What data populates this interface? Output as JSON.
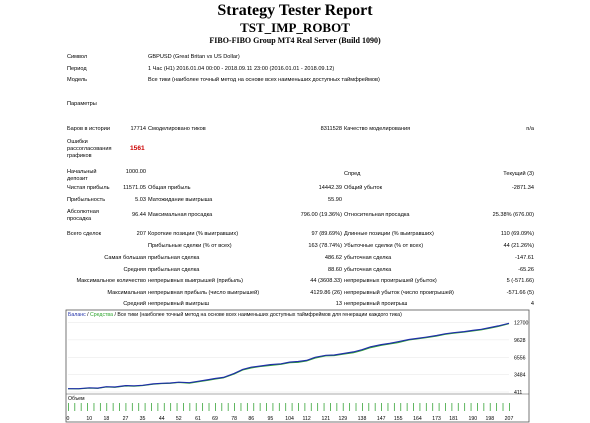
{
  "report": {
    "title": "Strategy Tester Report",
    "robot": "TST_IMP_ROBOT",
    "server": "FIBO-FIBO Group MT4 Real Server (Build 1090)"
  },
  "header": {
    "symbol_label": "Символ",
    "symbol_value": "GBPUSD (Great Britan vs US Dollar)",
    "period_label": "Период",
    "period_value": "1 Час (H1) 2016.01.04 00:00 - 2018.09.11 23:00 (2016.01.01 - 2018.09.12)",
    "model_label": "Модель",
    "model_value": "Все тики (наиболее точный метод на основе всех наименьших доступных таймфреймов)",
    "params_label": "Параметры"
  },
  "stats": {
    "bars_label": "Баров в истории",
    "bars_value": "17714",
    "ticks_label": "Смоделировано тиков",
    "ticks_value": "8311528",
    "quality_label": "Качество моделирования",
    "quality_value": "n/a",
    "errors_label": "Ошибки рассогласования графиков",
    "errors_value": "1561",
    "deposit_label": "Начальный депозит",
    "deposit_value": "1000.00",
    "spread_label": "Спред",
    "spread_value": "Текущий (3)",
    "net_profit_label": "Чистая прибыль",
    "net_profit_value": "11571.05",
    "gross_profit_label": "Общая прибыль",
    "gross_profit_value": "14442.39",
    "gross_loss_label": "Общий убыток",
    "gross_loss_value": "-2871.34",
    "profit_factor_label": "Прибыльность",
    "profit_factor_value": "5.03",
    "expected_payoff_label": "Матожидание выигрыша",
    "expected_payoff_value": "55.90",
    "abs_drawdown_label": "Абсолютная просадка",
    "abs_drawdown_value": "96.44",
    "max_drawdown_label": "Максимальная просадка",
    "max_drawdown_value": "796.00 (19.36%)",
    "rel_drawdown_label": "Относительная просадка",
    "rel_drawdown_value": "25.38% (676.00)",
    "total_trades_label": "Всего сделок",
    "total_trades_value": "207",
    "short_label": "Короткие позиции (% выигравших)",
    "short_value": "97 (89.69%)",
    "long_label": "Длинные позиции (% выигравших)",
    "long_value": "110 (69.09%)",
    "profit_trades_label": "Прибыльные сделки (% от всех)",
    "profit_trades_value": "163 (78.74%)",
    "loss_trades_label": "Убыточные сделки (% от всех)",
    "loss_trades_value": "44 (21.26%)",
    "largest_label": "Самая большая",
    "largest_profit_label": "прибыльная сделка",
    "largest_profit_value": "486.62",
    "largest_loss_label": "убыточная сделка",
    "largest_loss_value": "-147.61",
    "average_label": "Средняя",
    "average_profit_label": "прибыльная сделка",
    "average_profit_value": "88.60",
    "average_loss_label": "убыточная сделка",
    "average_loss_value": "-65.26",
    "max_count_label": "Максимальное количество",
    "consec_wins_label": "непрерывных выигрышей (прибыль)",
    "consec_wins_value": "44 (3608.33)",
    "consec_losses_label": "непрерывных проигрышей (убыток)",
    "consec_losses_value": "5 (-571.66)",
    "max_label": "Максимальная",
    "consec_profit_label": "непрерывная прибыль (число выигрышей)",
    "consec_profit_value": "4129.86 (26)",
    "consec_loss_label": "непрерывный убыток (число проигрышей)",
    "consec_loss_value": "-571.66 (5)",
    "avg_label": "Средний",
    "avg_wins_label": "непрерывный выигрыш",
    "avg_wins_value": "13",
    "avg_losses_label": "непрерывный проигрыш",
    "avg_losses_value": "4"
  },
  "chart_data": {
    "type": "line",
    "legend_balance": "Баланс",
    "legend_sep": "/",
    "legend_equity": "Средства",
    "legend_sep2": "/",
    "legend_text": "Все тики (наиболее точный метод на основе всех наименьших доступных таймфреймов для генерации каждого тика)",
    "volume_label": "Объем",
    "colors": {
      "balance": "#1f2fa8",
      "equity": "#2fa52f",
      "volume": "#3aa53a",
      "border": "#555555",
      "grid": "#dddddd"
    },
    "ylim": [
      411,
      13500
    ],
    "yticks": [
      12700,
      9628,
      6556,
      3484,
      411
    ],
    "x_ticks": [
      0,
      10,
      18,
      27,
      35,
      44,
      52,
      61,
      69,
      78,
      86,
      95,
      104,
      112,
      121,
      129,
      138,
      147,
      155,
      164,
      173,
      181,
      190,
      198,
      207
    ],
    "x_max": 207,
    "balance": [
      [
        0,
        1000
      ],
      [
        5,
        990
      ],
      [
        10,
        1150
      ],
      [
        14,
        1100
      ],
      [
        18,
        1350
      ],
      [
        22,
        1300
      ],
      [
        27,
        1550
      ],
      [
        31,
        1500
      ],
      [
        35,
        1600
      ],
      [
        40,
        1850
      ],
      [
        44,
        1950
      ],
      [
        48,
        2000
      ],
      [
        52,
        2150
      ],
      [
        57,
        2050
      ],
      [
        61,
        2300
      ],
      [
        66,
        2600
      ],
      [
        69,
        2800
      ],
      [
        73,
        3000
      ],
      [
        78,
        3700
      ],
      [
        82,
        4400
      ],
      [
        86,
        4800
      ],
      [
        90,
        5000
      ],
      [
        95,
        5250
      ],
      [
        100,
        5400
      ],
      [
        104,
        5700
      ],
      [
        108,
        5800
      ],
      [
        112,
        6000
      ],
      [
        116,
        6550
      ],
      [
        121,
        6900
      ],
      [
        125,
        6950
      ],
      [
        129,
        7200
      ],
      [
        134,
        7500
      ],
      [
        138,
        7900
      ],
      [
        142,
        8400
      ],
      [
        147,
        8800
      ],
      [
        151,
        9000
      ],
      [
        155,
        9300
      ],
      [
        160,
        9700
      ],
      [
        164,
        9900
      ],
      [
        168,
        10100
      ],
      [
        173,
        10400
      ],
      [
        177,
        10700
      ],
      [
        181,
        10900
      ],
      [
        186,
        11100
      ],
      [
        190,
        11300
      ],
      [
        194,
        11500
      ],
      [
        198,
        11800
      ],
      [
        202,
        12100
      ],
      [
        207,
        12571
      ]
    ],
    "equity": [
      [
        0,
        1000
      ],
      [
        5,
        960
      ],
      [
        10,
        1100
      ],
      [
        14,
        1050
      ],
      [
        18,
        1300
      ],
      [
        22,
        1220
      ],
      [
        27,
        1480
      ],
      [
        31,
        1420
      ],
      [
        35,
        1550
      ],
      [
        40,
        1780
      ],
      [
        44,
        1900
      ],
      [
        48,
        1930
      ],
      [
        52,
        2100
      ],
      [
        57,
        1950
      ],
      [
        61,
        2200
      ],
      [
        66,
        2500
      ],
      [
        69,
        2700
      ],
      [
        73,
        2900
      ],
      [
        78,
        3600
      ],
      [
        82,
        4300
      ],
      [
        86,
        4650
      ],
      [
        90,
        4900
      ],
      [
        95,
        5100
      ],
      [
        100,
        5300
      ],
      [
        104,
        5600
      ],
      [
        108,
        5650
      ],
      [
        112,
        5900
      ],
      [
        116,
        6400
      ],
      [
        121,
        6800
      ],
      [
        125,
        6850
      ],
      [
        129,
        7100
      ],
      [
        134,
        7350
      ],
      [
        138,
        7750
      ],
      [
        142,
        8250
      ],
      [
        147,
        8650
      ],
      [
        151,
        8900
      ],
      [
        155,
        9150
      ],
      [
        160,
        9600
      ],
      [
        164,
        9800
      ],
      [
        168,
        10000
      ],
      [
        173,
        10300
      ],
      [
        177,
        10600
      ],
      [
        181,
        10800
      ],
      [
        186,
        11000
      ],
      [
        190,
        11200
      ],
      [
        194,
        11400
      ],
      [
        198,
        11700
      ],
      [
        202,
        12000
      ],
      [
        207,
        12500
      ]
    ]
  }
}
